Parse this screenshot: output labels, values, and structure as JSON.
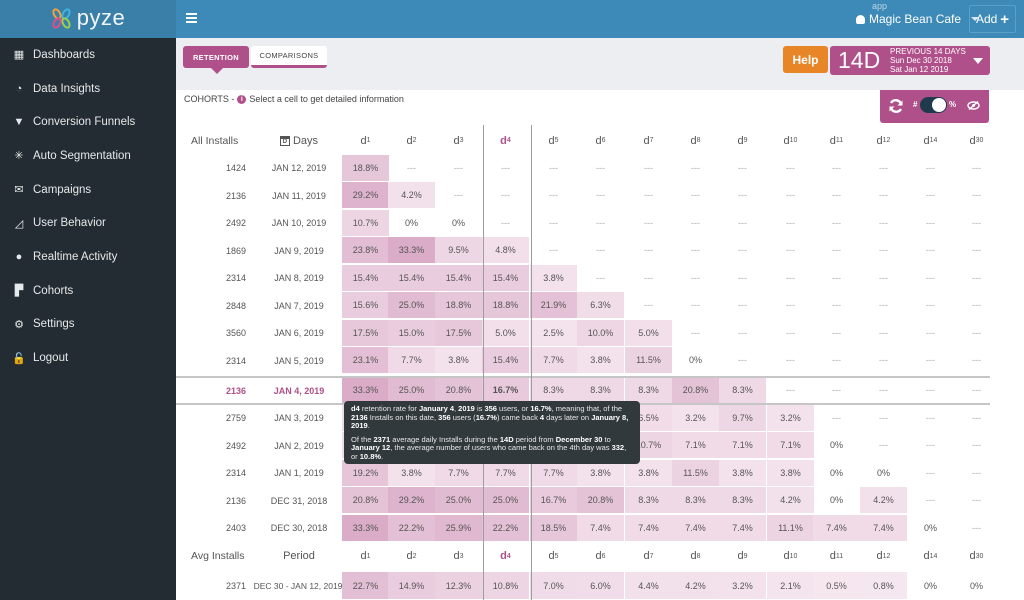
{
  "app": {
    "logo_text": "pyze",
    "app_label": "app",
    "app_name": "Magic Bean Cafe",
    "add_label": "Add",
    "add_icon": "plus-icon"
  },
  "sidebar": {
    "items": [
      {
        "label": "Dashboards",
        "icon": "dashboard-icon",
        "glyph": "▦"
      },
      {
        "label": "Data Insights",
        "icon": "gauge-icon",
        "glyph": "◔"
      },
      {
        "label": "Conversion Funnels",
        "icon": "funnel-icon",
        "glyph": "▼"
      },
      {
        "label": "Auto Segmentation",
        "icon": "segmentation-icon",
        "glyph": "✳"
      },
      {
        "label": "Campaigns",
        "icon": "envelope-icon",
        "glyph": "✉"
      },
      {
        "label": "User Behavior",
        "icon": "area-chart-icon",
        "glyph": "◿"
      },
      {
        "label": "Realtime Activity",
        "icon": "globe-icon",
        "glyph": "●"
      },
      {
        "label": "Cohorts",
        "icon": "cohorts-icon",
        "glyph": "▛"
      },
      {
        "label": "Settings",
        "icon": "gear-icon",
        "glyph": "⚙"
      },
      {
        "label": "Logout",
        "icon": "unlock-icon",
        "glyph": "🔓"
      }
    ]
  },
  "tabs": {
    "retention": "RETENTION",
    "comparisons": "COMPARISONS",
    "active": "retention"
  },
  "help_label": "Help",
  "date_range": {
    "short": "14D",
    "title": "PREVIOUS 14 DAYS",
    "start": "Sun Dec 30 2018",
    "end": "Sat Jan 12 2019"
  },
  "cohorts_header": {
    "prefix": "COHORTS  -",
    "info": "Select a cell to get detailed information"
  },
  "toolbar": {
    "hash_label": "#",
    "pct_label": "%",
    "toggle_state": "percent"
  },
  "table": {
    "installs_header": "All Installs",
    "days_header": "Days",
    "day_columns": [
      "1",
      "2",
      "3",
      "4",
      "5",
      "6",
      "7",
      "8",
      "9",
      "10",
      "11",
      "12",
      "14",
      "30"
    ],
    "highlight_column": "4",
    "selected_row": 8,
    "rows": [
      {
        "installs": "1424",
        "date": "JAN 12, 2019",
        "values": [
          "18.8%",
          "---",
          "---",
          "---",
          "---",
          "---",
          "---",
          "---",
          "---",
          "---",
          "---",
          "---",
          "---",
          "---"
        ]
      },
      {
        "installs": "2136",
        "date": "JAN 11, 2019",
        "values": [
          "29.2%",
          "4.2%",
          "---",
          "---",
          "---",
          "---",
          "---",
          "---",
          "---",
          "---",
          "---",
          "---",
          "---",
          "---"
        ]
      },
      {
        "installs": "2492",
        "date": "JAN 10, 2019",
        "values": [
          "10.7%",
          "0%",
          "0%",
          "---",
          "---",
          "---",
          "---",
          "---",
          "---",
          "---",
          "---",
          "---",
          "---",
          "---"
        ]
      },
      {
        "installs": "1869",
        "date": "JAN 9, 2019",
        "values": [
          "23.8%",
          "33.3%",
          "9.5%",
          "4.8%",
          "---",
          "---",
          "---",
          "---",
          "---",
          "---",
          "---",
          "---",
          "---",
          "---"
        ]
      },
      {
        "installs": "2314",
        "date": "JAN 8, 2019",
        "values": [
          "15.4%",
          "15.4%",
          "15.4%",
          "15.4%",
          "3.8%",
          "---",
          "---",
          "---",
          "---",
          "---",
          "---",
          "---",
          "---",
          "---"
        ]
      },
      {
        "installs": "2848",
        "date": "JAN 7, 2019",
        "values": [
          "15.6%",
          "25.0%",
          "18.8%",
          "18.8%",
          "21.9%",
          "6.3%",
          "---",
          "---",
          "---",
          "---",
          "---",
          "---",
          "---",
          "---"
        ]
      },
      {
        "installs": "3560",
        "date": "JAN 6, 2019",
        "values": [
          "17.5%",
          "15.0%",
          "17.5%",
          "5.0%",
          "2.5%",
          "10.0%",
          "5.0%",
          "---",
          "---",
          "---",
          "---",
          "---",
          "---",
          "---"
        ]
      },
      {
        "installs": "2314",
        "date": "JAN 5, 2019",
        "values": [
          "23.1%",
          "7.7%",
          "3.8%",
          "15.4%",
          "7.7%",
          "3.8%",
          "11.5%",
          "0%",
          "---",
          "---",
          "---",
          "---",
          "---",
          "---"
        ]
      },
      {
        "installs": "2136",
        "date": "JAN 4, 2019",
        "values": [
          "33.3%",
          "25.0%",
          "20.8%",
          "16.7%",
          "8.3%",
          "8.3%",
          "8.3%",
          "20.8%",
          "8.3%",
          "---",
          "---",
          "---",
          "---",
          "---"
        ]
      },
      {
        "installs": "2759",
        "date": "JAN 3, 2019",
        "values": [
          "",
          "",
          "",
          "",
          "",
          "",
          "6.5%",
          "3.2%",
          "9.7%",
          "3.2%",
          "---",
          "---",
          "---",
          "---"
        ]
      },
      {
        "installs": "2492",
        "date": "JAN 2, 2019",
        "values": [
          "",
          "",
          "",
          "",
          "",
          "",
          "10.7%",
          "7.1%",
          "7.1%",
          "7.1%",
          "0%",
          "---",
          "---",
          "---"
        ]
      },
      {
        "installs": "2314",
        "date": "JAN 1, 2019",
        "values": [
          "19.2%",
          "3.8%",
          "7.7%",
          "7.7%",
          "7.7%",
          "3.8%",
          "3.8%",
          "11.5%",
          "3.8%",
          "3.8%",
          "0%",
          "0%",
          "---",
          "---"
        ]
      },
      {
        "installs": "2136",
        "date": "DEC 31, 2018",
        "values": [
          "20.8%",
          "29.2%",
          "25.0%",
          "25.0%",
          "16.7%",
          "20.8%",
          "8.3%",
          "8.3%",
          "8.3%",
          "4.2%",
          "0%",
          "4.2%",
          "---",
          "---"
        ]
      },
      {
        "installs": "2403",
        "date": "DEC 30, 2018",
        "values": [
          "33.3%",
          "22.2%",
          "25.9%",
          "22.2%",
          "18.5%",
          "7.4%",
          "7.4%",
          "7.4%",
          "7.4%",
          "11.1%",
          "7.4%",
          "7.4%",
          "0%",
          "---"
        ]
      }
    ],
    "summary_header": {
      "installs": "Avg Installs",
      "period": "Period"
    },
    "summary": {
      "installs": "2371",
      "period": "DEC 30 - JAN 12, 2019",
      "values": [
        "22.7%",
        "14.9%",
        "12.3%",
        "10.8%",
        "7.0%",
        "6.0%",
        "4.4%",
        "4.2%",
        "3.2%",
        "2.1%",
        "0.5%",
        "0.8%",
        "0%",
        "0%"
      ]
    }
  },
  "tooltip": {
    "p1": [
      {
        "t": "d4",
        "b": true
      },
      {
        "t": " retention rate for "
      },
      {
        "t": "January 4",
        "b": true
      },
      {
        "t": ", "
      },
      {
        "t": "2019",
        "b": true
      },
      {
        "t": " is "
      },
      {
        "t": "356",
        "b": true
      },
      {
        "t": " users, or "
      },
      {
        "t": "16.7%",
        "b": true
      },
      {
        "t": ", meaning that, of the "
      },
      {
        "t": "2136",
        "b": true
      },
      {
        "t": " Installs on this date, "
      },
      {
        "t": "356",
        "b": true
      },
      {
        "t": " users ("
      },
      {
        "t": "16.7%",
        "b": true
      },
      {
        "t": ") came back "
      },
      {
        "t": "4",
        "b": true
      },
      {
        "t": " days later on "
      },
      {
        "t": "January 8, 2019",
        "b": true
      },
      {
        "t": "."
      }
    ],
    "p2": [
      {
        "t": "Of the "
      },
      {
        "t": "2371",
        "b": true
      },
      {
        "t": " average daily Installs during the "
      },
      {
        "t": "14D",
        "b": true
      },
      {
        "t": " period from "
      },
      {
        "t": "December 30",
        "b": true
      },
      {
        "t": " to "
      },
      {
        "t": "January 12",
        "b": true
      },
      {
        "t": ", the average number of users who came back on the 4th day was "
      },
      {
        "t": "332",
        "b": true
      },
      {
        "t": ", or "
      },
      {
        "t": "10.8%",
        "b": true
      },
      {
        "t": "."
      }
    ]
  },
  "colors": {
    "accent": "#b0508a",
    "topbar": "#3d8ab8",
    "sidebar": "#232c32",
    "help": "#e88527",
    "heat_base": "#f5e6ef",
    "heat_max": "#d9a9c6"
  }
}
